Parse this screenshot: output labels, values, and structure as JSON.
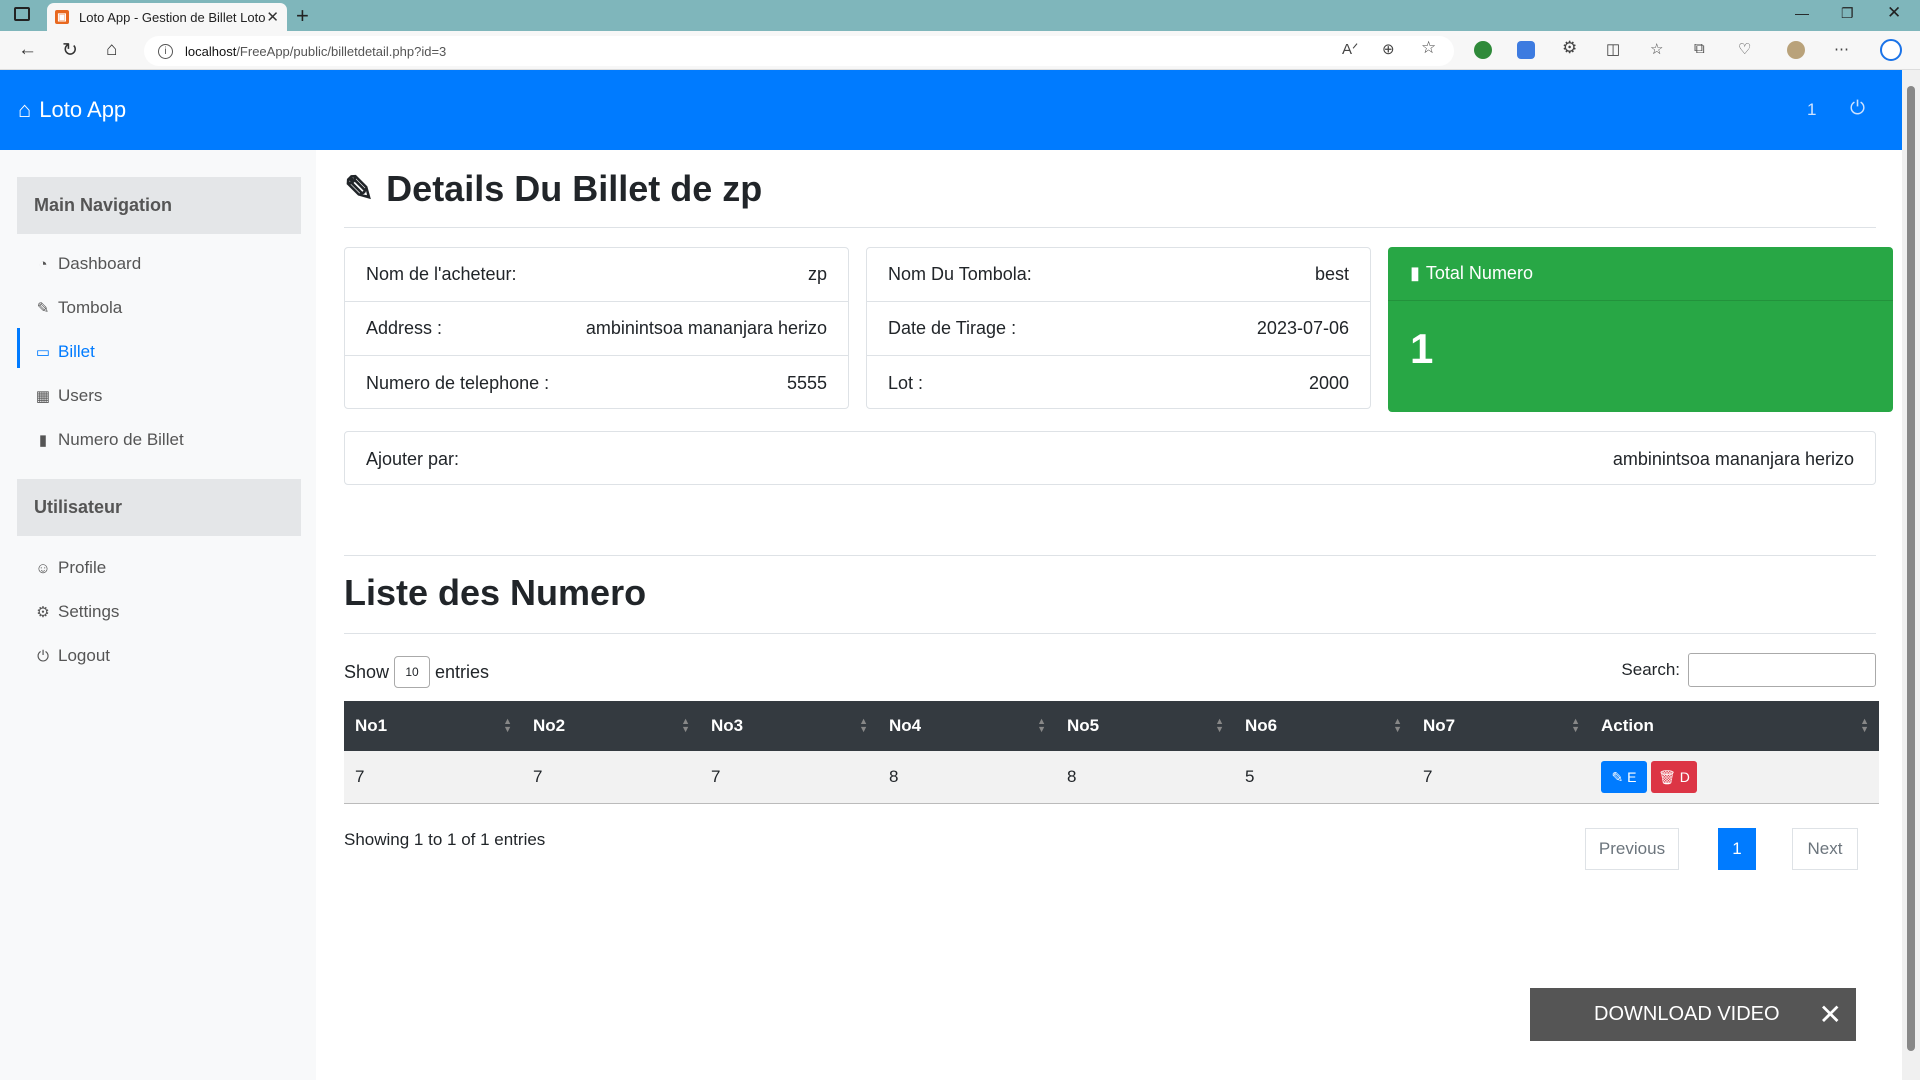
{
  "browser": {
    "tab_title": "Loto App - Gestion de Billet Loto",
    "url_host": "localhost",
    "url_path": "/FreeApp/public/billetdetail.php?id=3"
  },
  "navbar": {
    "brand": "Loto App",
    "notification_count": "1"
  },
  "sidebar": {
    "section_main": "Main Navigation",
    "items": [
      {
        "label": "Dashboard",
        "icon": "dashboard-icon"
      },
      {
        "label": "Tombola",
        "icon": "edit-icon"
      },
      {
        "label": "Billet",
        "icon": "monitor-icon"
      },
      {
        "label": "Users",
        "icon": "table-icon"
      },
      {
        "label": "Numero de Billet",
        "icon": "bar-chart-icon"
      }
    ],
    "section_user": "Utilisateur",
    "user_items": [
      {
        "label": "Profile",
        "icon": "user-icon"
      },
      {
        "label": "Settings",
        "icon": "gear-icon"
      },
      {
        "label": "Logout",
        "icon": "power-icon"
      }
    ]
  },
  "page": {
    "title": "Details Du Billet de zp",
    "buyer": {
      "name_label": "Nom de l'acheteur:",
      "name_value": "zp",
      "address_label": "Address :",
      "address_value": "ambinintsoa mananjara herizo",
      "phone_label": "Numero de telephone :",
      "phone_value": "5555"
    },
    "tombola": {
      "name_label": "Nom Du Tombola:",
      "name_value": "best",
      "date_label": "Date de Tirage :",
      "date_value": "2023-07-06",
      "lot_label": "Lot :",
      "lot_value": "2000"
    },
    "total": {
      "label": "Total Numero",
      "value": "1"
    },
    "added_by": {
      "label": "Ajouter par:",
      "value": "ambinintsoa mananjara herizo"
    },
    "list_title": "Liste des Numero",
    "show_label": "Show",
    "entries_select": "10",
    "entries_label": "entries",
    "search_label": "Search:",
    "table": {
      "headers": [
        "No1",
        "No2",
        "No3",
        "No4",
        "No5",
        "No6",
        "No7",
        "Action"
      ],
      "rows": [
        [
          "7",
          "7",
          "7",
          "8",
          "8",
          "5",
          "7"
        ]
      ],
      "edit_label": "E",
      "delete_label": "D"
    },
    "showing": "Showing 1 to 1 of 1 entries",
    "pagination": {
      "previous": "Previous",
      "current": "1",
      "next": "Next"
    }
  },
  "overlay": {
    "download_label": "DOWNLOAD VIDEO"
  },
  "colors": {
    "primary": "#007bff",
    "success": "#28a745",
    "danger": "#dc3545",
    "table_header": "#343a40"
  }
}
